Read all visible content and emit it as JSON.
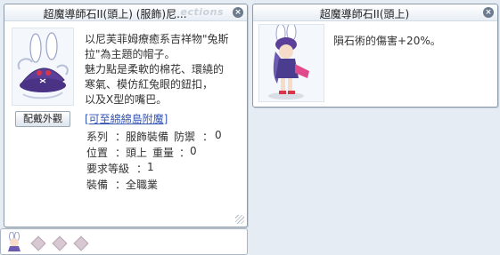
{
  "item_window": {
    "title": "超魔導師石II(頭上) (服飾)尼...",
    "watermark": "ections",
    "button_label": "配戴外觀",
    "description": [
      "以尼芙菲姆療癒系吉祥物\"兔斯",
      "拉\"為主題的帽子。",
      "魅力點是柔軟的棉花、環繞的",
      "寒氣、模仿紅兔眼的鈕扣，",
      "以及X型的嘴巴。"
    ],
    "link_text": "[可至綿綿島附魔]",
    "props": {
      "series_label": "系列",
      "series_value": "服飾裝備",
      "defense_label": "防禦",
      "defense_value": "0",
      "position_label": "位置",
      "position_value": "頭上",
      "weight_label": "重量",
      "weight_value": "0",
      "level_label": "要求等級",
      "level_value": "1",
      "equip_label": "裝備",
      "equip_value": "全職業"
    }
  },
  "card_window": {
    "title": "超魔導師石II(頭上)",
    "description": "隕石術的傷害+20%。"
  },
  "colors": {
    "link": "#3556b4",
    "border": "#8c9aaa"
  },
  "icons": {
    "close": "close-icon",
    "resize": "resize-grip-icon"
  }
}
